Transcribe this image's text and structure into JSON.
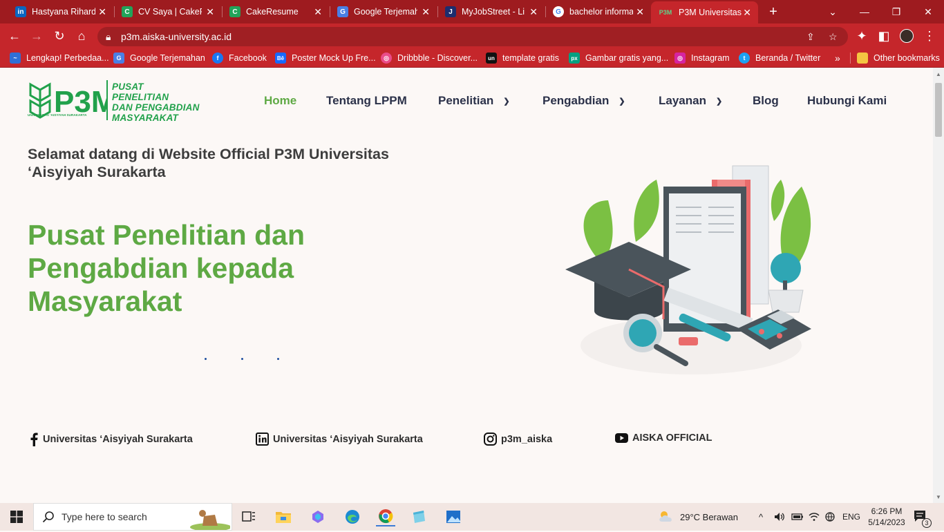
{
  "browser": {
    "tabs": [
      {
        "label": "Hastyana Rihardin",
        "icon": "linkedin-icon",
        "color": "#0a66c2",
        "glyph": "in"
      },
      {
        "label": "CV Saya | CakeRe",
        "icon": "cakeresume-icon",
        "color": "#22a35a",
        "glyph": "C"
      },
      {
        "label": "CakeResume",
        "icon": "cakeresume-icon",
        "color": "#22a35a",
        "glyph": "C"
      },
      {
        "label": "Google Terjemah",
        "icon": "google-translate-icon",
        "color": "#4a7fe5",
        "glyph": "G"
      },
      {
        "label": "MyJobStreet - Li",
        "icon": "jobstreet-icon",
        "color": "#1d2d6e",
        "glyph": "J"
      },
      {
        "label": "bachelor informa",
        "icon": "google-icon",
        "color": "#ffffff",
        "glyph": "G"
      },
      {
        "label": "P3M Universitas",
        "icon": "p3m-icon",
        "color": "#21a14b",
        "glyph": "P3M"
      }
    ],
    "address": "p3m.aiska-university.ac.id",
    "bookmarks": [
      {
        "label": "Lengkap! Perbedaa...",
        "color": "#2f6fd6",
        "glyph": "~"
      },
      {
        "label": "Google Terjemahan",
        "color": "#4a7fe5",
        "glyph": "G"
      },
      {
        "label": "Facebook",
        "color": "#1877f2",
        "glyph": "f"
      },
      {
        "label": "Poster Mock Up Fre...",
        "color": "#1769ff",
        "glyph": "Bē"
      },
      {
        "label": "Dribbble - Discover...",
        "color": "#ea4c89",
        "glyph": "◎"
      },
      {
        "label": "template gratis",
        "color": "#111111",
        "glyph": "un"
      },
      {
        "label": "Gambar gratis yang...",
        "color": "#05a081",
        "glyph": "px"
      },
      {
        "label": "Instagram",
        "color": "#d6249f",
        "glyph": "◎"
      },
      {
        "label": "Beranda / Twitter",
        "color": "#1da1f2",
        "glyph": "t"
      }
    ],
    "more_bookmarks": "»",
    "other_bookmarks": "Other bookmarks"
  },
  "site": {
    "logo_mark": "P3M",
    "logo_lines": [
      "PUSAT",
      "PENELITIAN",
      "DAN PENGABDIAN",
      "MASYARAKAT"
    ],
    "logo_sub": "UNIVERSITAS 'AISYIYAH SURAKARTA",
    "menu": {
      "home": "Home",
      "tentang": "Tentang LPPM",
      "penelitian": "Penelitian",
      "pengabdian": "Pengabdian",
      "layanan": "Layanan",
      "blog": "Blog",
      "hubungi": "Hubungi Kami"
    },
    "welcome": "Selamat datang di Website Official P3M Universitas ‘Aisyiyah Surakarta",
    "hero_title": "Pusat Penelitian dan Pengabdian kepada Masyarakat",
    "social": {
      "facebook": "Universitas ‘Aisyiyah Surakarta",
      "linkedin": "Universitas ‘Aisyiyah Surakarta",
      "instagram": "p3m_aiska",
      "youtube": "AISKA OFFICIAL"
    },
    "colors": {
      "accent_green": "#5ea944",
      "nav_text": "#2b3149",
      "brand_green": "#21a14b"
    }
  },
  "taskbar": {
    "search_placeholder": "Type here to search",
    "weather": "29°C  Berawan",
    "language": "ENG",
    "time": "6:26 PM",
    "date": "5/14/2023",
    "notifications": "3"
  }
}
